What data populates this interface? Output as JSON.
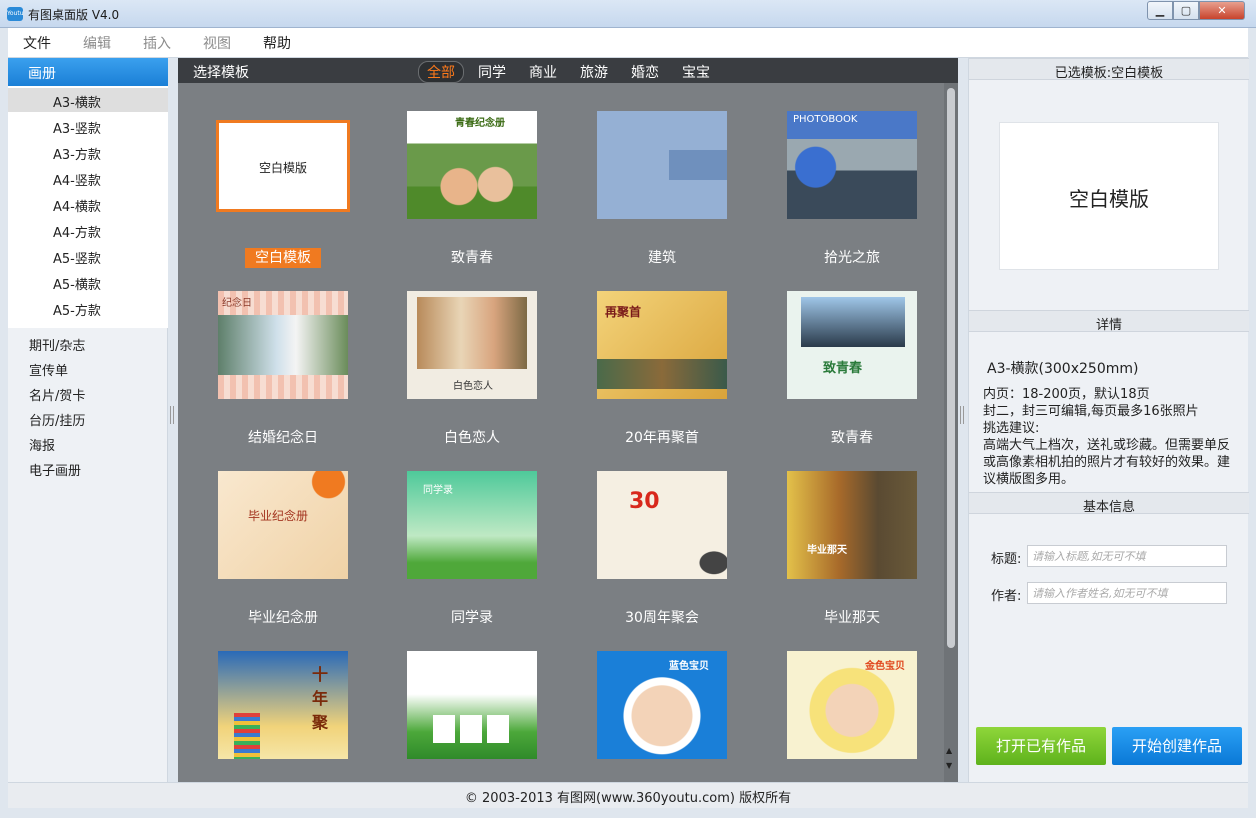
{
  "window": {
    "title": "有图桌面版 V4.0",
    "icon_label": "Youtu",
    "min_icon": "minimize-icon",
    "max_icon": "maximize-icon",
    "close_icon": "close-icon"
  },
  "menu": [
    "文件",
    "编辑",
    "插入",
    "视图",
    "帮助"
  ],
  "sidebar": {
    "category_active": "画册",
    "sub_items": [
      "A3-横款",
      "A3-竖款",
      "A3-方款",
      "A4-竖款",
      "A4-横款",
      "A4-方款",
      "A5-竖款",
      "A5-横款",
      "A5-方款"
    ],
    "selected_sub": "A3-横款",
    "categories": [
      "期刊/杂志",
      "宣传单",
      "名片/贺卡",
      "台历/挂历",
      "海报",
      "电子画册"
    ]
  },
  "center": {
    "title": "选择模板",
    "filters": [
      "全部",
      "同学",
      "商业",
      "旅游",
      "婚恋",
      "宝宝"
    ],
    "active_filter": "全部",
    "templates": [
      {
        "name": "空白模板",
        "thumb_text": "空白模版"
      },
      {
        "name": "致青春",
        "thumb_text": "青春纪念册"
      },
      {
        "name": "建筑",
        "thumb_text": ""
      },
      {
        "name": "拾光之旅",
        "thumb_text": "PHOTOBOOK"
      },
      {
        "name": "结婚纪念日",
        "thumb_text": "纪念日"
      },
      {
        "name": "白色恋人",
        "thumb_text": "白色恋人"
      },
      {
        "name": "20年再聚首",
        "thumb_text": "再聚首"
      },
      {
        "name": "致青春",
        "thumb_text": "致青春"
      },
      {
        "name": "毕业纪念册",
        "thumb_text": "毕业纪念册"
      },
      {
        "name": "同学录",
        "thumb_text": "同学录"
      },
      {
        "name": "30周年聚会",
        "thumb_text": "30"
      },
      {
        "name": "毕业那天",
        "thumb_text": "毕业那天"
      },
      {
        "name": "",
        "thumb_text": "十年聚"
      },
      {
        "name": "",
        "thumb_text": ""
      },
      {
        "name": "",
        "thumb_text": "蓝色宝贝"
      },
      {
        "name": "",
        "thumb_text": "金色宝贝"
      }
    ]
  },
  "right": {
    "selected_header": "已选模板:空白模板",
    "preview_text": "空白模版",
    "detail_header": "详情",
    "detail_size": "A3-横款(300x250mm)",
    "detail_lines": [
      "内页：18-200页，默认18页",
      "封二，封三可编辑,每页最多16张照片",
      "挑选建议:",
      "高端大气上档次，送礼或珍藏。但需要单反或高像素相机拍的照片才有较好的效果。建议横版图多用。"
    ],
    "basic_header": "基本信息",
    "title_label": "标题:",
    "title_placeholder": "请输入标题,如无可不填",
    "author_label": "作者:",
    "author_placeholder": "请输入作者姓名,如无可不填",
    "open_button": "打开已有作品",
    "create_button": "开始创建作品"
  },
  "status": {
    "copyright": "© 2003-2013 有图网(www.360youtu.com) 版权所有"
  },
  "colors": {
    "accent": "#f07a20",
    "selected_blue": "#1b7fd6",
    "open_green": "#6cc026",
    "create_blue": "#1589e6"
  }
}
